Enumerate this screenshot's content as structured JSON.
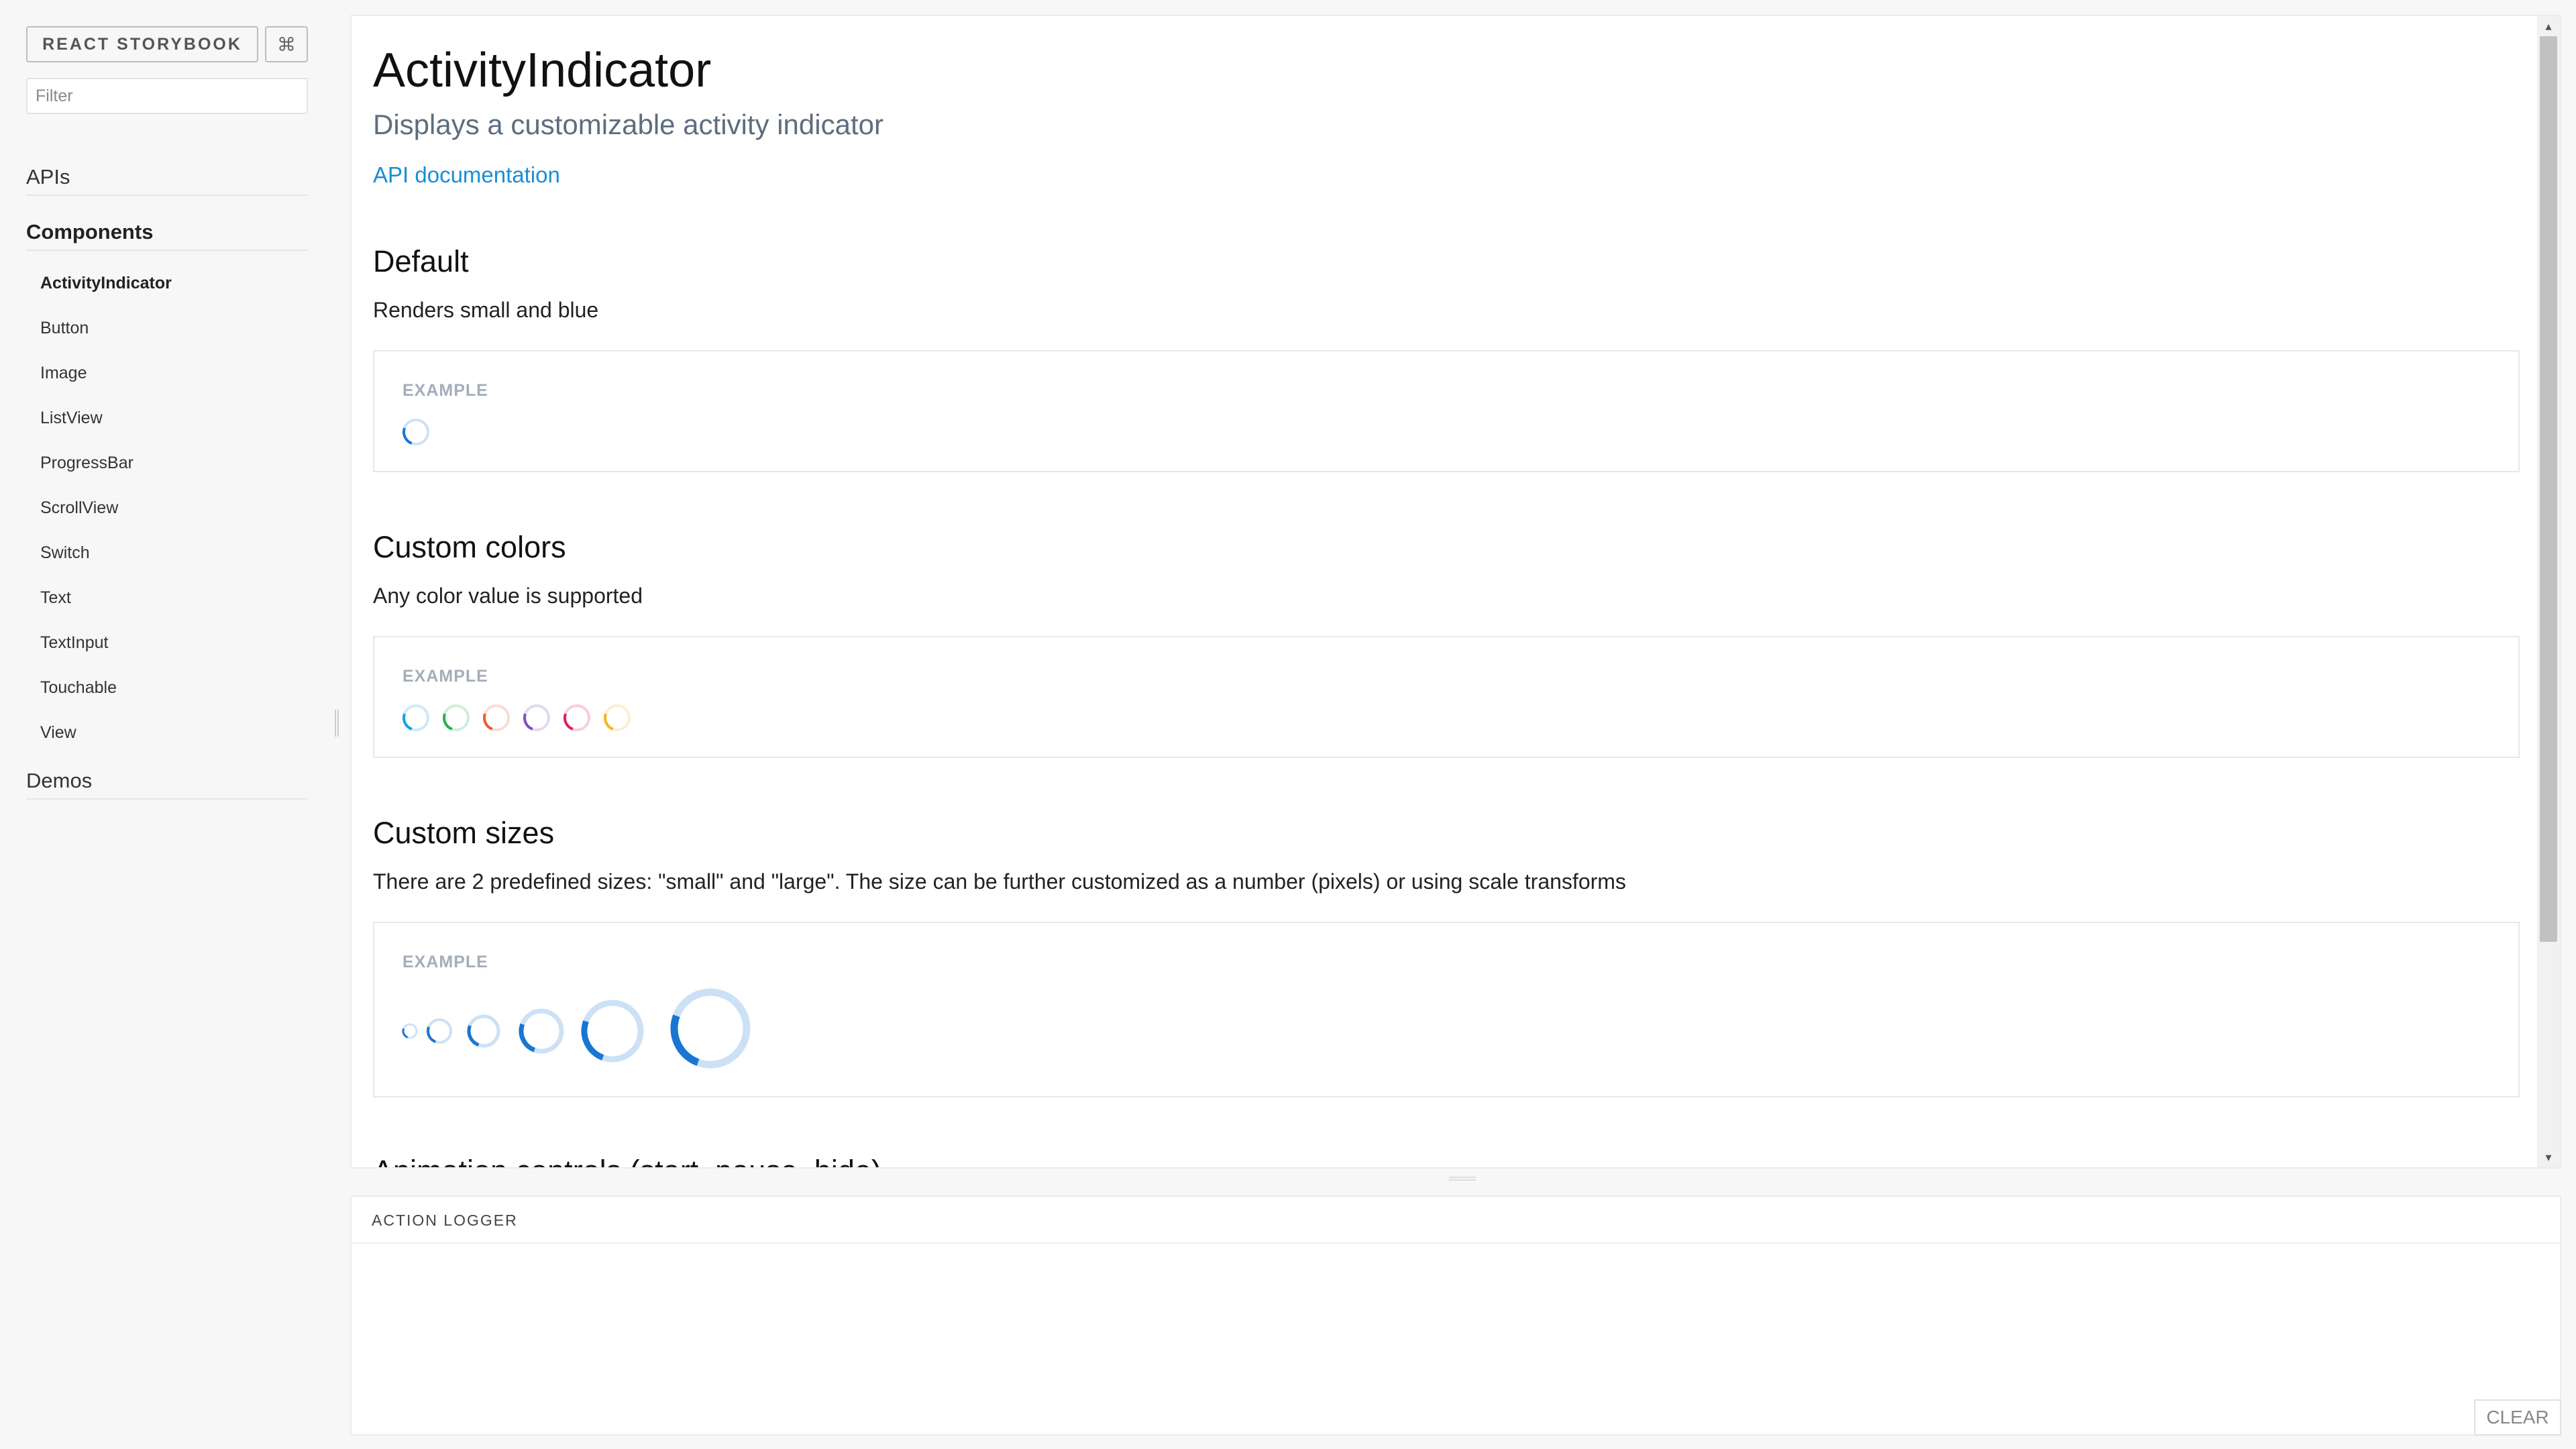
{
  "sidebar": {
    "brand": "REACT STORYBOOK",
    "shortcut_icon": "command-key-icon",
    "shortcut_glyph": "⌘",
    "filter_placeholder": "Filter",
    "sections": {
      "apis": "APIs",
      "components": "Components",
      "demos": "Demos"
    },
    "items": [
      "ActivityIndicator",
      "Button",
      "Image",
      "ListView",
      "ProgressBar",
      "ScrollView",
      "Switch",
      "Text",
      "TextInput",
      "Touchable",
      "View"
    ],
    "active_item": "ActivityIndicator"
  },
  "main": {
    "title": "ActivityIndicator",
    "subtitle": "Displays a customizable activity indicator",
    "doc_link": "API documentation",
    "sections": [
      {
        "heading": "Default",
        "description": "Renders small and blue",
        "example_label": "EXAMPLE"
      },
      {
        "heading": "Custom colors",
        "description": "Any color value is supported",
        "example_label": "EXAMPLE"
      },
      {
        "heading": "Custom sizes",
        "description": "There are 2 predefined sizes: \"small\" and \"large\". The size can be further customized as a number (pixels) or using scale transforms",
        "example_label": "EXAMPLE"
      }
    ],
    "next_section_heading": "Animation controls (start, pause, hide)"
  },
  "spinner_colors": {
    "default": "#1976d2",
    "custom": [
      "#0fa3e8",
      "#24b24b",
      "#ee5a2f",
      "#7b4fc6",
      "#e51c5c",
      "#f5b321"
    ]
  },
  "logger": {
    "title": "ACTION LOGGER",
    "clear": "CLEAR"
  }
}
